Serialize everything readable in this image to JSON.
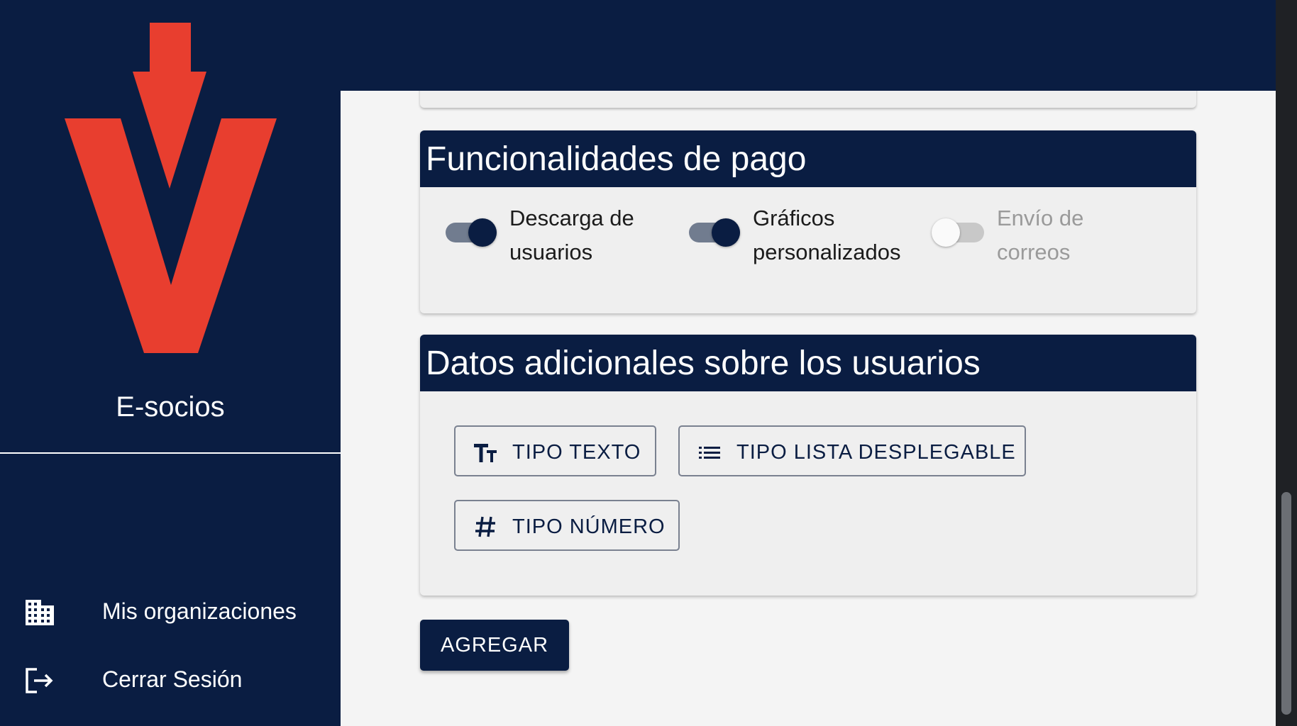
{
  "sidebar": {
    "brand_name": "E-socios",
    "items": [
      {
        "label": "Mis organizaciones",
        "icon": "building-icon"
      },
      {
        "label": "Cerrar Sesión",
        "icon": "logout-icon"
      }
    ]
  },
  "payment_card": {
    "title": "Funcionalidades de pago",
    "toggles": [
      {
        "line1": "Descarga de",
        "line2": "usuarios",
        "checked": true,
        "disabled": false
      },
      {
        "line1": "Gráficos",
        "line2": "personalizados",
        "checked": true,
        "disabled": false
      },
      {
        "line1": "Envío de",
        "line2": "correos",
        "checked": false,
        "disabled": true
      }
    ]
  },
  "data_card": {
    "title": "Datos adicionales sobre los usuarios",
    "buttons": [
      {
        "label": "TIPO TEXTO",
        "icon": "text-fields-icon"
      },
      {
        "label": "TIPO LISTA DESPLEGABLE",
        "icon": "list-icon"
      },
      {
        "label": "TIPO NÚMERO",
        "icon": "hashtag-icon"
      }
    ]
  },
  "actions": {
    "add_label": "AGREGAR"
  },
  "colors": {
    "navy": "#0a1d42",
    "logo_red": "#e83e2f",
    "content_bg": "#f4f4f4",
    "card_bg": "#efefef"
  }
}
